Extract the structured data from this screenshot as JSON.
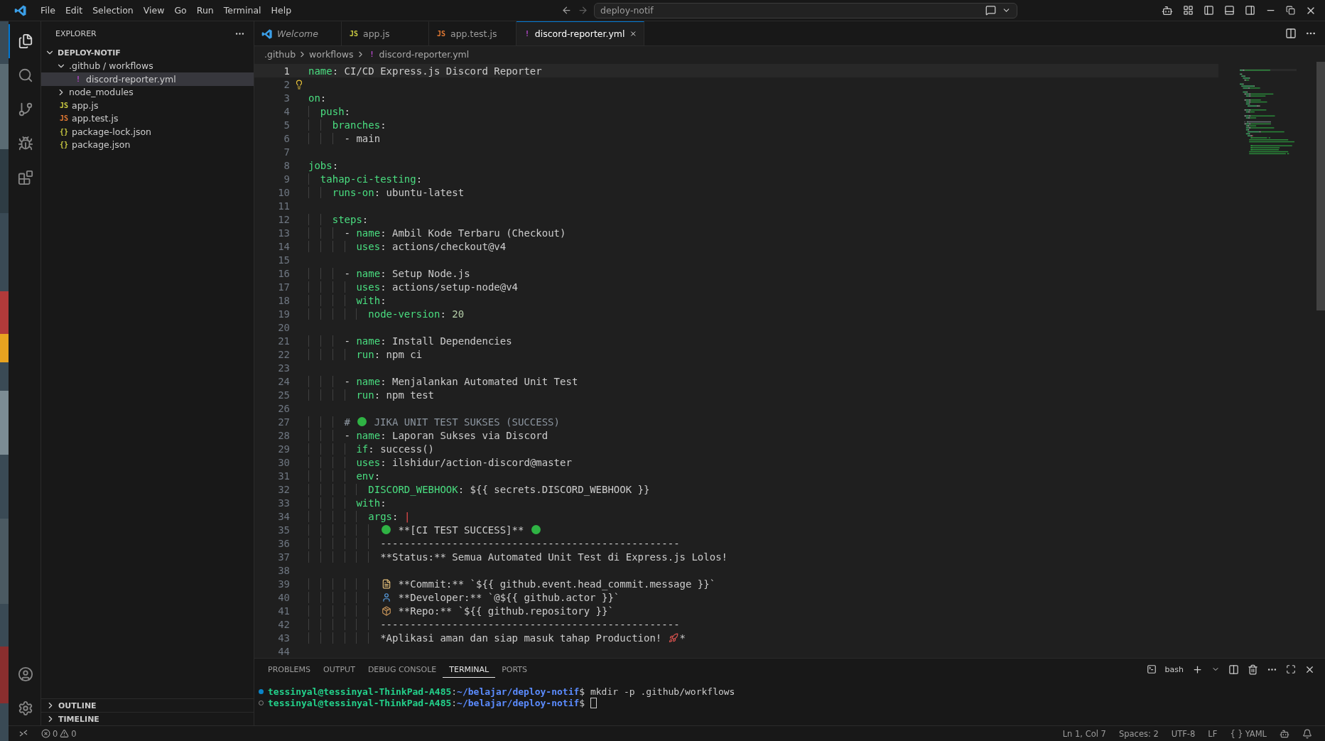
{
  "title_bar": {
    "menu": [
      "File",
      "Edit",
      "Selection",
      "View",
      "Go",
      "Run",
      "Terminal",
      "Help"
    ],
    "search": {
      "value": "deploy-notif"
    }
  },
  "activity_bar": {
    "items": [
      {
        "kind": "files",
        "selected": true
      },
      {
        "kind": "search",
        "selected": false
      },
      {
        "kind": "source-control",
        "selected": false
      },
      {
        "kind": "run",
        "selected": false
      },
      {
        "kind": "extensions",
        "selected": false
      }
    ]
  },
  "sidebar": {
    "title": "EXPLORER",
    "root": {
      "label": "DEPLOY-NOTIF",
      "expanded": true,
      "children": [
        {
          "label": ".github / workflows",
          "kind": "folder",
          "expanded": true,
          "selected": false,
          "children": [
            {
              "label": "discord-reporter.yml",
              "kind": "yaml",
              "glyph": "!",
              "selected": true
            }
          ]
        },
        {
          "label": "node_modules",
          "kind": "folder",
          "expanded": false,
          "selected": false
        },
        {
          "label": "app.js",
          "kind": "js",
          "glyph": "JS",
          "selected": false
        },
        {
          "label": "app.test.js",
          "kind": "test-js",
          "glyph": "JS",
          "selected": false
        },
        {
          "label": "package-lock.json",
          "kind": "json",
          "glyph": "{}",
          "selected": false
        },
        {
          "label": "package.json",
          "kind": "json",
          "glyph": "{}",
          "selected": false
        }
      ]
    },
    "sections": [
      {
        "label": "OUTLINE",
        "expanded": false
      },
      {
        "label": "TIMELINE",
        "expanded": false
      }
    ]
  },
  "tabs": [
    {
      "label": "Welcome",
      "kind": "welcome",
      "selected": false
    },
    {
      "label": "app.js",
      "kind": "js",
      "glyph": "JS",
      "selected": false
    },
    {
      "label": "app.test.js",
      "kind": "test-js",
      "glyph": "JS",
      "selected": false
    },
    {
      "label": "discord-reporter.yml",
      "kind": "yaml",
      "glyph": "!",
      "selected": true
    }
  ],
  "breadcrumb": [
    {
      "label": ".github"
    },
    {
      "label": "workflows"
    },
    {
      "label": "discord-reporter.yml",
      "kind": "yaml",
      "glyph": "!"
    }
  ],
  "editor": {
    "lines": [
      {
        "n": "1",
        "selected": true,
        "hint": false,
        "tokens": [
          {
            "kind": "key",
            "text": "name"
          },
          {
            "kind": "punct",
            "text": ": "
          },
          {
            "kind": "value",
            "text": "CI/CD Express.js Discord Reporter"
          }
        ]
      },
      {
        "n": "2",
        "selected": false,
        "hint": true
      },
      {
        "n": "3",
        "selected": false,
        "hint": false,
        "tokens": [
          {
            "kind": "key",
            "text": "on"
          },
          {
            "kind": "punct",
            "text": ":"
          }
        ]
      },
      {
        "n": "4",
        "selected": false,
        "hint": false,
        "tokens": [
          {
            "kind": "key",
            "text": "  push"
          },
          {
            "kind": "punct",
            "text": ":"
          }
        ]
      },
      {
        "n": "5",
        "selected": false,
        "hint": false,
        "tokens": [
          {
            "kind": "key",
            "text": "    branches"
          },
          {
            "kind": "punct",
            "text": ":"
          }
        ]
      },
      {
        "n": "6",
        "selected": false,
        "hint": false,
        "tokens": [
          {
            "kind": "punct",
            "text": "      - "
          },
          {
            "kind": "value",
            "text": "main"
          }
        ]
      },
      {
        "n": "7",
        "selected": false,
        "hint": false
      },
      {
        "n": "8",
        "selected": false,
        "hint": false,
        "tokens": [
          {
            "kind": "key",
            "text": "jobs"
          },
          {
            "kind": "punct",
            "text": ":"
          }
        ]
      },
      {
        "n": "9",
        "selected": false,
        "hint": false,
        "tokens": [
          {
            "kind": "key",
            "text": "  tahap-ci-testing"
          },
          {
            "kind": "punct",
            "text": ":"
          }
        ]
      },
      {
        "n": "10",
        "selected": false,
        "hint": false,
        "tokens": [
          {
            "kind": "key",
            "text": "    runs-on"
          },
          {
            "kind": "punct",
            "text": ": "
          },
          {
            "kind": "value",
            "text": "ubuntu-latest"
          }
        ]
      },
      {
        "n": "11",
        "selected": false,
        "hint": false
      },
      {
        "n": "12",
        "selected": false,
        "hint": false,
        "tokens": [
          {
            "kind": "key",
            "text": "    steps"
          },
          {
            "kind": "punct",
            "text": ":"
          }
        ]
      },
      {
        "n": "13",
        "selected": false,
        "hint": false,
        "tokens": [
          {
            "kind": "punct",
            "text": "      - "
          },
          {
            "kind": "key",
            "text": "name"
          },
          {
            "kind": "punct",
            "text": ": "
          },
          {
            "kind": "value",
            "text": "Ambil Kode Terbaru (Checkout)"
          }
        ]
      },
      {
        "n": "14",
        "selected": false,
        "hint": false,
        "tokens": [
          {
            "kind": "key",
            "text": "        uses"
          },
          {
            "kind": "punct",
            "text": ": "
          },
          {
            "kind": "value",
            "text": "actions/checkout@v4"
          }
        ]
      },
      {
        "n": "15",
        "selected": false,
        "hint": false
      },
      {
        "n": "16",
        "selected": false,
        "hint": false,
        "tokens": [
          {
            "kind": "punct",
            "text": "      - "
          },
          {
            "kind": "key",
            "text": "name"
          },
          {
            "kind": "punct",
            "text": ": "
          },
          {
            "kind": "value",
            "text": "Setup Node.js"
          }
        ]
      },
      {
        "n": "17",
        "selected": false,
        "hint": false,
        "tokens": [
          {
            "kind": "key",
            "text": "        uses"
          },
          {
            "kind": "punct",
            "text": ": "
          },
          {
            "kind": "value",
            "text": "actions/setup-node@v4"
          }
        ]
      },
      {
        "n": "18",
        "selected": false,
        "hint": false,
        "tokens": [
          {
            "kind": "key",
            "text": "        with"
          },
          {
            "kind": "punct",
            "text": ":"
          }
        ]
      },
      {
        "n": "19",
        "selected": false,
        "hint": false,
        "tokens": [
          {
            "kind": "key",
            "text": "          node-version"
          },
          {
            "kind": "punct",
            "text": ": "
          },
          {
            "kind": "number",
            "text": "20"
          }
        ]
      },
      {
        "n": "20",
        "selected": false,
        "hint": false
      },
      {
        "n": "21",
        "selected": false,
        "hint": false,
        "tokens": [
          {
            "kind": "punct",
            "text": "      - "
          },
          {
            "kind": "key",
            "text": "name"
          },
          {
            "kind": "punct",
            "text": ": "
          },
          {
            "kind": "value",
            "text": "Install Dependencies"
          }
        ]
      },
      {
        "n": "22",
        "selected": false,
        "hint": false,
        "tokens": [
          {
            "kind": "key",
            "text": "        run"
          },
          {
            "kind": "punct",
            "text": ": "
          },
          {
            "kind": "value",
            "text": "npm ci"
          }
        ]
      },
      {
        "n": "23",
        "selected": false,
        "hint": false
      },
      {
        "n": "24",
        "selected": false,
        "hint": false,
        "tokens": [
          {
            "kind": "punct",
            "text": "      - "
          },
          {
            "kind": "key",
            "text": "name"
          },
          {
            "kind": "punct",
            "text": ": "
          },
          {
            "kind": "value",
            "text": "Menjalankan Automated Unit Test"
          }
        ]
      },
      {
        "n": "25",
        "selected": false,
        "hint": false,
        "tokens": [
          {
            "kind": "key",
            "text": "        run"
          },
          {
            "kind": "punct",
            "text": ": "
          },
          {
            "kind": "value",
            "text": "npm test"
          }
        ]
      },
      {
        "n": "26",
        "selected": false,
        "hint": false
      },
      {
        "n": "27",
        "selected": false,
        "hint": false,
        "tokens": [
          {
            "kind": "comment",
            "text": "      #"
          },
          {
            "kind": "circle"
          },
          {
            "kind": "comment",
            "text": "JIKA UNIT TEST SUKSES (SUCCESS)"
          }
        ]
      },
      {
        "n": "28",
        "selected": false,
        "hint": false,
        "tokens": [
          {
            "kind": "punct",
            "text": "      - "
          },
          {
            "kind": "key",
            "text": "name"
          },
          {
            "kind": "punct",
            "text": ": "
          },
          {
            "kind": "value",
            "text": "Laporan Sukses via Discord"
          }
        ]
      },
      {
        "n": "29",
        "selected": false,
        "hint": false,
        "tokens": [
          {
            "kind": "key",
            "text": "        if"
          },
          {
            "kind": "punct",
            "text": ": "
          },
          {
            "kind": "value",
            "text": "success()"
          }
        ]
      },
      {
        "n": "30",
        "selected": false,
        "hint": false,
        "tokens": [
          {
            "kind": "key",
            "text": "        uses"
          },
          {
            "kind": "punct",
            "text": ": "
          },
          {
            "kind": "value",
            "text": "ilshidur/action-discord@master"
          }
        ]
      },
      {
        "n": "31",
        "selected": false,
        "hint": false,
        "tokens": [
          {
            "kind": "key",
            "text": "        env"
          },
          {
            "kind": "punct",
            "text": ":"
          }
        ]
      },
      {
        "n": "32",
        "selected": false,
        "hint": false,
        "tokens": [
          {
            "kind": "key",
            "text": "          DISCORD_WEBHOOK"
          },
          {
            "kind": "punct",
            "text": ": "
          },
          {
            "kind": "value",
            "text": "${{ secrets.DISCORD_WEBHOOK }}"
          }
        ]
      },
      {
        "n": "33",
        "selected": false,
        "hint": false,
        "tokens": [
          {
            "kind": "key",
            "text": "        with"
          },
          {
            "kind": "punct",
            "text": ":"
          }
        ]
      },
      {
        "n": "34",
        "selected": false,
        "hint": false,
        "tokens": [
          {
            "kind": "key",
            "text": "          args"
          },
          {
            "kind": "punct",
            "text": ": "
          },
          {
            "kind": "pipe",
            "text": "|"
          }
        ]
      },
      {
        "n": "35",
        "selected": false,
        "hint": false,
        "tokens": [
          {
            "kind": "circle"
          },
          {
            "kind": "value",
            "text": "**[CI TEST SUCCESS]**"
          },
          {
            "kind": "circle"
          }
        ]
      },
      {
        "n": "36",
        "selected": false,
        "hint": false,
        "tokens": [
          {
            "kind": "value",
            "text": "            --------------------------------------------------"
          }
        ]
      },
      {
        "n": "37",
        "selected": false,
        "hint": false,
        "tokens": [
          {
            "kind": "value",
            "text": "            **Status:** Semua Automated Unit Test di Express.js Lolos!"
          }
        ]
      },
      {
        "n": "38",
        "selected": false,
        "hint": false
      },
      {
        "n": "39",
        "selected": false,
        "hint": false,
        "tokens": [
          {
            "kind": "memo"
          },
          {
            "kind": "value",
            "text": "**Commit:** `${{ github.event.head_commit.message }}`"
          }
        ]
      },
      {
        "n": "40",
        "selected": false,
        "hint": false,
        "tokens": [
          {
            "kind": "person"
          },
          {
            "kind": "value",
            "text": "**Developer:** `@${{ github.actor }}`"
          }
        ]
      },
      {
        "n": "41",
        "selected": false,
        "hint": false,
        "tokens": [
          {
            "kind": "package"
          },
          {
            "kind": "value",
            "text": "**Repo:** `${{ github.repository }}`"
          }
        ]
      },
      {
        "n": "42",
        "selected": false,
        "hint": false,
        "tokens": [
          {
            "kind": "value",
            "text": "            --------------------------------------------------"
          }
        ]
      },
      {
        "n": "43",
        "selected": false,
        "hint": false,
        "tokens": [
          {
            "kind": "value",
            "text": "            *Aplikasi aman dan siap masuk tahap Production!"
          },
          {
            "kind": "rocket"
          },
          {
            "kind": "value",
            "text": "*"
          }
        ]
      },
      {
        "n": "44",
        "selected": false,
        "hint": false
      }
    ]
  },
  "panel": {
    "tabs": [
      {
        "label": "PROBLEMS",
        "selected": false
      },
      {
        "label": "OUTPUT",
        "selected": false
      },
      {
        "label": "DEBUG CONSOLE",
        "selected": false
      },
      {
        "label": "TERMINAL",
        "selected": true
      },
      {
        "label": "PORTS",
        "selected": false
      }
    ],
    "shell": "bash",
    "terminal": [
      {
        "finished": true,
        "user": "tessinyal@tessinyal-ThinkPad-A485",
        "sep": ":",
        "path": "~/belajar/deploy-notif",
        "prompt": "$",
        "command": "mkdir -p .github/workflows",
        "cursor": false
      },
      {
        "finished": false,
        "user": "tessinyal@tessinyal-ThinkPad-A485",
        "sep": ":",
        "path": "~/belajar/deploy-notif",
        "prompt": "$",
        "cursor": true
      }
    ]
  },
  "status_bar": {
    "errors": "0",
    "warnings": "0",
    "items": [
      "Ln 1, Col 7",
      "Spaces: 2",
      "UTF-8",
      "LF"
    ],
    "language_icon": "{ }",
    "language": "YAML"
  }
}
